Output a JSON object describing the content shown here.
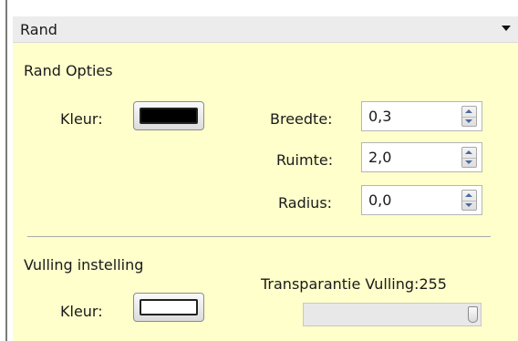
{
  "header": {
    "title": "Rand"
  },
  "rand_opties": {
    "section_title": "Rand Opties",
    "kleur_label": "Kleur:",
    "kleur_color": "#000000",
    "fields": [
      {
        "label": "Breedte:",
        "value": "0,3"
      },
      {
        "label": "Ruimte:",
        "value": "2,0"
      },
      {
        "label": "Radius:",
        "value": "0,0"
      }
    ]
  },
  "vulling": {
    "section_title": "Vulling instelling",
    "kleur_label": "Kleur:",
    "kleur_color": "#ffffff",
    "transparantie_label": "Transparantie Vulling:",
    "transparantie_value": "255",
    "slider_fraction": 1.0
  },
  "colors": {
    "panel_background": "#ffffcc",
    "header_background": "#ececec",
    "spin_arrow": "#4a6aa0"
  },
  "icons": {
    "collapse": "triangle-down",
    "spinner_up": "triangle-up",
    "spinner_down": "triangle-down"
  }
}
